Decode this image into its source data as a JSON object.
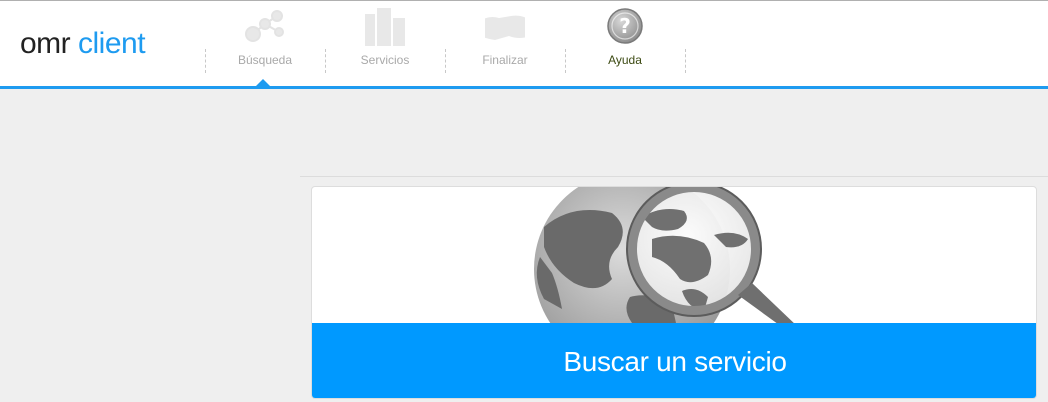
{
  "app": {
    "logo_part1": "omr",
    "logo_part2": "client"
  },
  "nav": {
    "items": [
      {
        "label": "Búsqueda",
        "icon": "network-search-icon",
        "state": "active"
      },
      {
        "label": "Servicios",
        "icon": "buildings-icon",
        "state": "disabled"
      },
      {
        "label": "Finalizar",
        "icon": "handshake-icon",
        "state": "disabled"
      },
      {
        "label": "Ayuda",
        "icon": "help-question-icon",
        "state": "enabled"
      }
    ]
  },
  "main": {
    "hero_image": "globe-magnifier-illustration",
    "cta_label": "Buscar un servicio"
  },
  "colors": {
    "accent": "#1e9bf0",
    "cta": "#0099ff",
    "page_bg": "#efefef"
  }
}
